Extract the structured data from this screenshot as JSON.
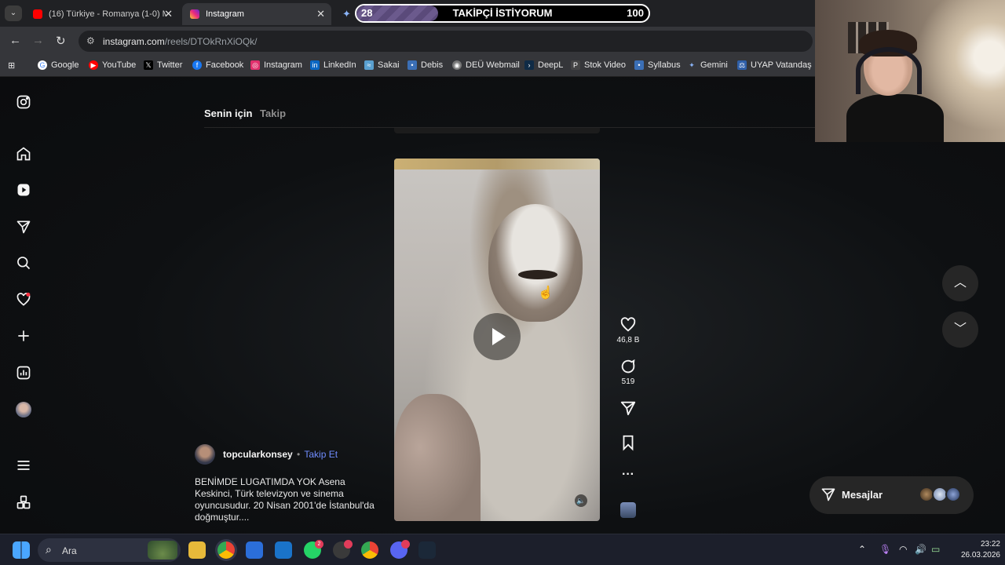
{
  "browser": {
    "tabs": [
      {
        "title": "(16) Türkiye - Romanya (1-0) M",
        "favicon_color": "#ff0000"
      },
      {
        "title": "Instagram",
        "favicon_color": "#e1306c"
      }
    ],
    "address": {
      "host": "instagram.com",
      "path": "/reels/DTOkRnXiOQk/"
    },
    "bookmarks": [
      {
        "label": "Google",
        "icon": "google-icon",
        "color": "#4285f4"
      },
      {
        "label": "YouTube",
        "icon": "youtube-icon",
        "color": "#ff0000"
      },
      {
        "label": "Twitter",
        "icon": "x-icon",
        "color": "#000000"
      },
      {
        "label": "Facebook",
        "icon": "facebook-icon",
        "color": "#1877f2"
      },
      {
        "label": "Instagram",
        "icon": "instagram-icon",
        "color": "#e1306c"
      },
      {
        "label": "LinkedIn",
        "icon": "linkedin-icon",
        "color": "#0a66c2"
      },
      {
        "label": "Sakai",
        "icon": "sakai-icon",
        "color": "#5aa0d0"
      },
      {
        "label": "Debis",
        "icon": "debis-icon",
        "color": "#3b6fb6"
      },
      {
        "label": "DEÜ Webmail",
        "icon": "webmail-icon",
        "color": "#777777"
      },
      {
        "label": "DeepL",
        "icon": "deepl-icon",
        "color": "#0f2b46"
      },
      {
        "label": "Stok Video",
        "icon": "stock-video-icon",
        "color": "#444444"
      },
      {
        "label": "Syllabus",
        "icon": "syllabus-icon",
        "color": "#3b6fb6"
      },
      {
        "label": "Gemini",
        "icon": "gemini-icon",
        "color": "#8ab4f8"
      },
      {
        "label": "UYAP Vatandaş",
        "icon": "uyap-icon",
        "color": "#2f5fa8"
      }
    ]
  },
  "overlay": {
    "left_value": "28",
    "text": "TAKİPÇİ İSTİYORUM",
    "right_value": "100",
    "progress": 0.28
  },
  "instagram": {
    "feed_tabs": {
      "active": "Senin için",
      "inactive": "Takip"
    },
    "post": {
      "username": "topcularkonsey",
      "separator": "•",
      "follow": "Takip Et",
      "caption": "BENİMDE LUGATIMDA YOK Asena Keskinci, Türk televizyon ve sinema oyuncusudur. 20 Nisan 2001'de İstanbul'da doğmuştur....",
      "likes": "46,8 B",
      "comments": "519"
    },
    "messages": {
      "label": "Mesajlar"
    }
  },
  "taskbar": {
    "search_label": "Ara",
    "time": "23:22",
    "date": "26.03.2026",
    "badges": {
      "whatsapp": "2"
    }
  },
  "colors": {
    "accent": "#708dff",
    "notification": "#ff3040"
  }
}
